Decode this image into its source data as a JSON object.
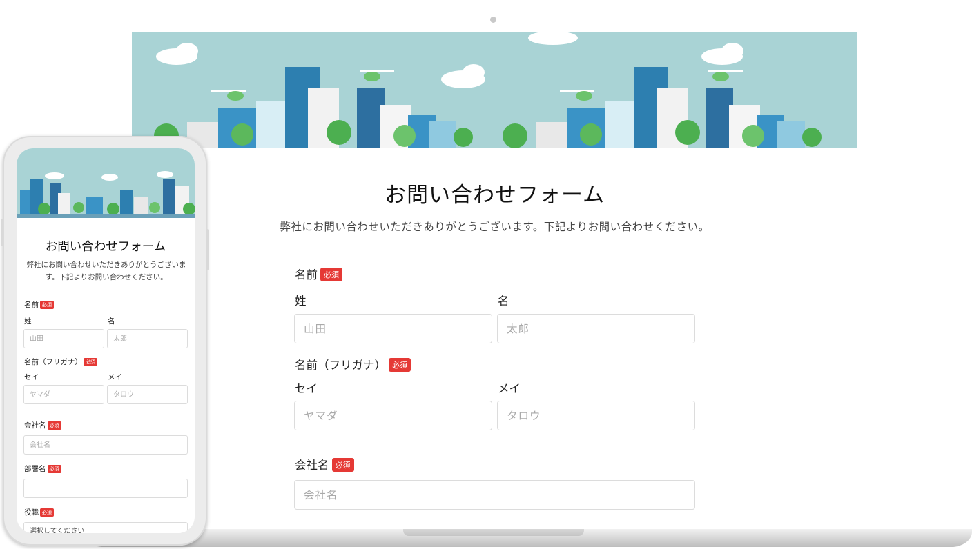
{
  "desktop": {
    "title": "お問い合わせフォーム",
    "subtitle": "弊社にお問い合わせいただきありがとうございます。下記よりお問い合わせください。",
    "required_badge": "必須",
    "name": {
      "label": "名前",
      "last_label": "姓",
      "first_label": "名",
      "last_placeholder": "山田",
      "first_placeholder": "太郎"
    },
    "kana": {
      "label": "名前（フリガナ）",
      "last_label": "セイ",
      "first_label": "メイ",
      "last_placeholder": "ヤマダ",
      "first_placeholder": "タロウ"
    },
    "company": {
      "label": "会社名",
      "placeholder": "会社名"
    }
  },
  "mobile": {
    "title": "お問い合わせフォーム",
    "subtitle": "弊社にお問い合わせいただきありがとうございます。下記よりお問い合わせください。",
    "required_badge": "必須",
    "name": {
      "label": "名前",
      "last_label": "姓",
      "first_label": "名",
      "last_placeholder": "山田",
      "first_placeholder": "太郎"
    },
    "kana": {
      "label": "名前（フリガナ）",
      "last_label": "セイ",
      "first_label": "メイ",
      "last_placeholder": "ヤマダ",
      "first_placeholder": "タロウ"
    },
    "company": {
      "label": "会社名",
      "placeholder": "会社名"
    },
    "department": {
      "label": "部署名",
      "placeholder": ""
    },
    "position": {
      "label": "役職",
      "placeholder": "選択してください"
    }
  },
  "colors": {
    "banner_sky": "#a9d3d5",
    "required": "#e53935",
    "building_blue": "#2d7fb0",
    "tree_green": "#4caf50"
  }
}
